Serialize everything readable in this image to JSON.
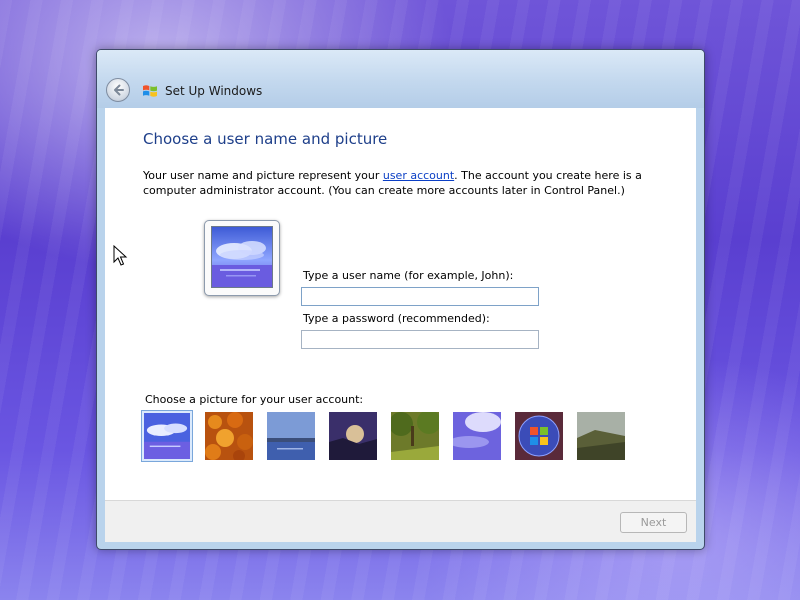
{
  "window": {
    "title": "Set Up Windows",
    "icon": "windows-logo-icon",
    "back_icon": "back-arrow-icon"
  },
  "page": {
    "heading": "Choose a user name and picture",
    "description_before_link": "Your user name and picture represent your ",
    "description_link": "user account",
    "description_after_link": ". The account you create here is a computer administrator account. (You can create more accounts later in Control Panel.)"
  },
  "form": {
    "username_label": "Type a user name (for example, John):",
    "username_value": "",
    "password_label": "Type a password (recommended):",
    "password_value": ""
  },
  "pictures": {
    "label": "Choose a picture for your user account:",
    "items": [
      {
        "name": "clouds-over-water",
        "selected": true
      },
      {
        "name": "autumn-leaves",
        "selected": false
      },
      {
        "name": "lake",
        "selected": false
      },
      {
        "name": "sunset",
        "selected": false
      },
      {
        "name": "forest-path",
        "selected": false
      },
      {
        "name": "purple-sky",
        "selected": false
      },
      {
        "name": "windows-logo-orb",
        "selected": false
      },
      {
        "name": "hillside",
        "selected": false
      }
    ]
  },
  "footer": {
    "next_label": "Next",
    "next_enabled": false
  },
  "colors": {
    "heading": "#1e3f8a",
    "link": "#0b3fc5",
    "titlebar": "#c3d8ee",
    "desktop": "#5a3fd0"
  }
}
